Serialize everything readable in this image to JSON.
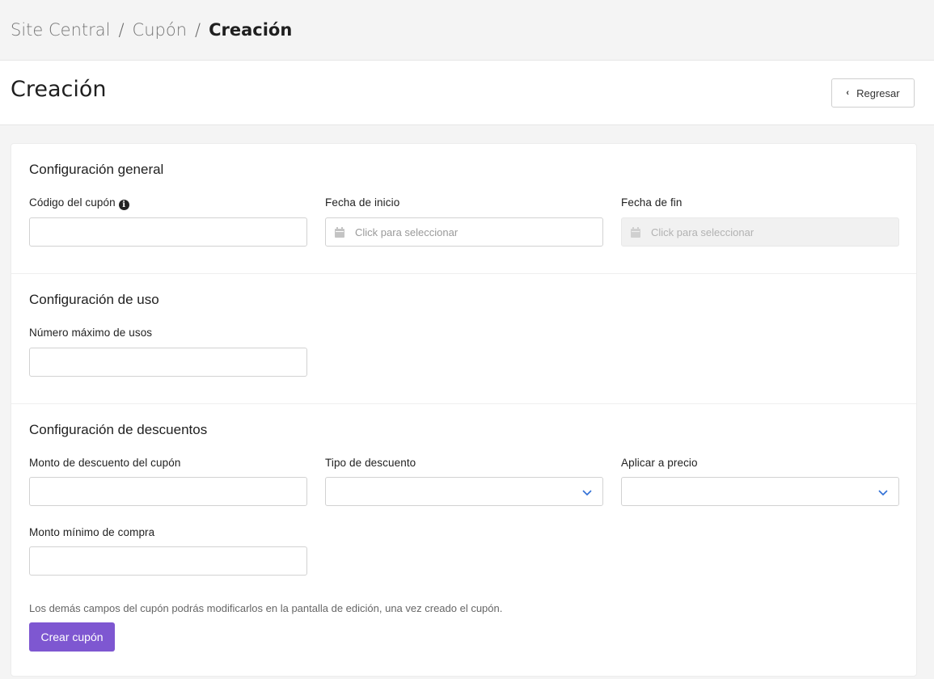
{
  "breadcrumb": {
    "items": [
      "Site Central",
      "Cupón",
      "Creación"
    ],
    "separator": "/"
  },
  "header": {
    "title": "Creación",
    "back_label": "Regresar"
  },
  "sections": {
    "general": {
      "title": "Configuración general",
      "coupon_code_label": "Código del cupón",
      "start_date_label": "Fecha de inicio",
      "start_date_placeholder": "Click para seleccionar",
      "end_date_label": "Fecha de fin",
      "end_date_placeholder": "Click para seleccionar"
    },
    "usage": {
      "title": "Configuración de uso",
      "max_uses_label": "Número máximo de usos"
    },
    "discounts": {
      "title": "Configuración de descuentos",
      "amount_label": "Monto de descuento del cupón",
      "type_label": "Tipo de descuento",
      "apply_to_label": "Aplicar a precio",
      "min_purchase_label": "Monto mínimo de compra",
      "help_text": "Los demás campos del cupón podrás modificarlos en la pantalla de edición, una vez creado el cupón.",
      "submit_label": "Crear cupón"
    }
  },
  "colors": {
    "primary_button": "#7e57d1",
    "chevron_accent": "#2f6fd6"
  },
  "icons": {
    "info": "info-circle-icon",
    "calendar": "calendar-icon",
    "dropdown": "chevron-down-icon",
    "back": "chevron-left-icon"
  }
}
